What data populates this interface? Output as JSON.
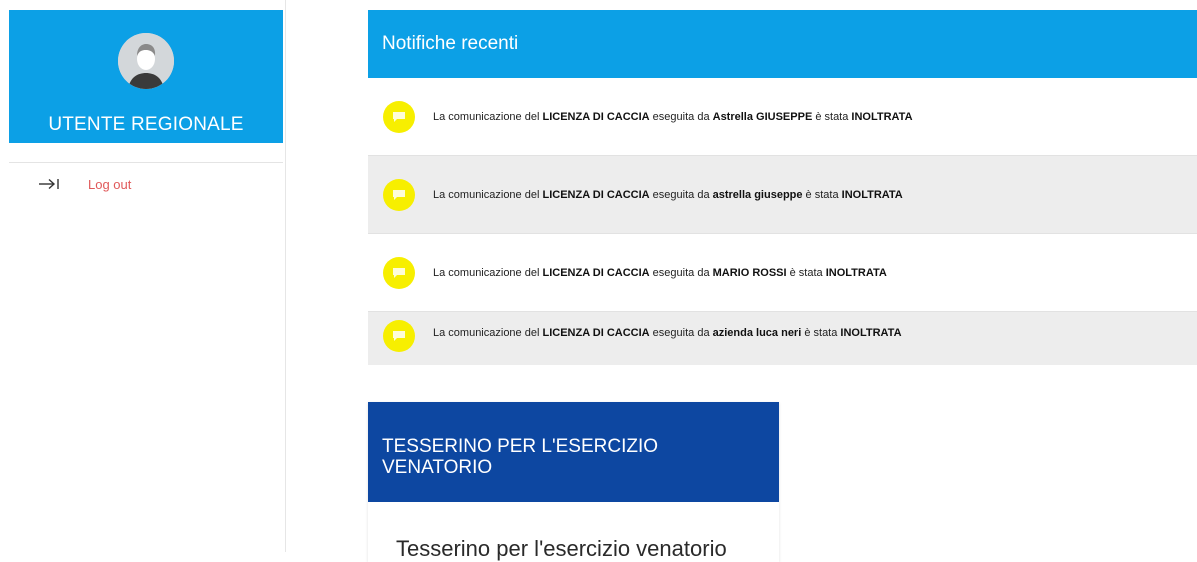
{
  "sidebar": {
    "user_name": "UTENTE REGIONALE",
    "logout_label": "Log out",
    "accent_color": "#0ca0e6"
  },
  "notifications": {
    "title": "Notifiche recenti",
    "items": [
      {
        "prefix": "La comunicazione del ",
        "license": "LICENZA DI CACCIA",
        "mid": " eseguita da ",
        "actor": "Astrella GIUSEPPE",
        "verb": " è stata ",
        "status": "INOLTRATA"
      },
      {
        "prefix": "La comunicazione del ",
        "license": "LICENZA DI CACCIA",
        "mid": " eseguita da ",
        "actor": "astrella giuseppe",
        "verb": " è stata ",
        "status": "INOLTRATA"
      },
      {
        "prefix": "La comunicazione del ",
        "license": "LICENZA DI CACCIA",
        "mid": " eseguita da ",
        "actor": "MARIO ROSSI",
        "verb": " è stata ",
        "status": "INOLTRATA"
      },
      {
        "prefix": "La comunicazione del ",
        "license": "LICENZA DI CACCIA",
        "mid": " eseguita da ",
        "actor": "azienda luca neri",
        "verb": " è stata ",
        "status": "INOLTRATA"
      }
    ],
    "icon": "chat-bubble-icon",
    "icon_color": "#f7ef00"
  },
  "card": {
    "header": "TESSERINO PER L'ESERCIZIO VENATORIO",
    "body": "Tesserino per l'esercizio venatorio",
    "header_color": "#0d47a1"
  }
}
